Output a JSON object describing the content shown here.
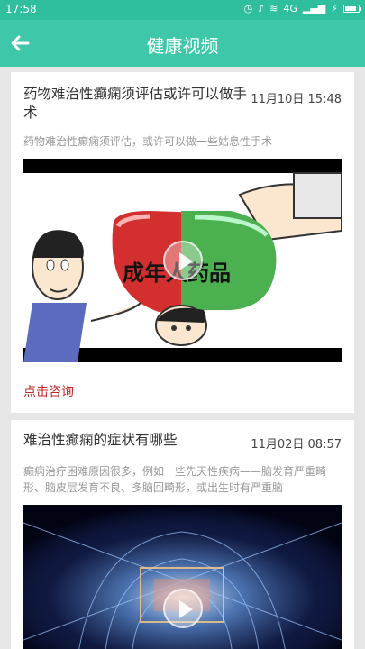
{
  "status": {
    "time": "17:58",
    "signal": "4G",
    "battery_level": 0.75
  },
  "header": {
    "title": "健康视频"
  },
  "articles": [
    {
      "title": "药物难治性癫痫须评估或许可以做手术",
      "date": "11月10日 15:48",
      "summary": "药物难治性癫痫须评估，或许可以做一些姑息性手术",
      "video_caption": "成年人药品",
      "action_label": "点击咨询"
    },
    {
      "title": "难治性癫痫的症状有哪些",
      "date": "11月02日 08:57",
      "summary": "癫痫治疗困难原因很多，例如一些先天性疾病——脑发育严重畸形、脑皮层发育不良、多脑回畸形，或出生时有严重脑"
    }
  ],
  "colors": {
    "accent": "#3ec7a8",
    "link": "#c62828"
  }
}
